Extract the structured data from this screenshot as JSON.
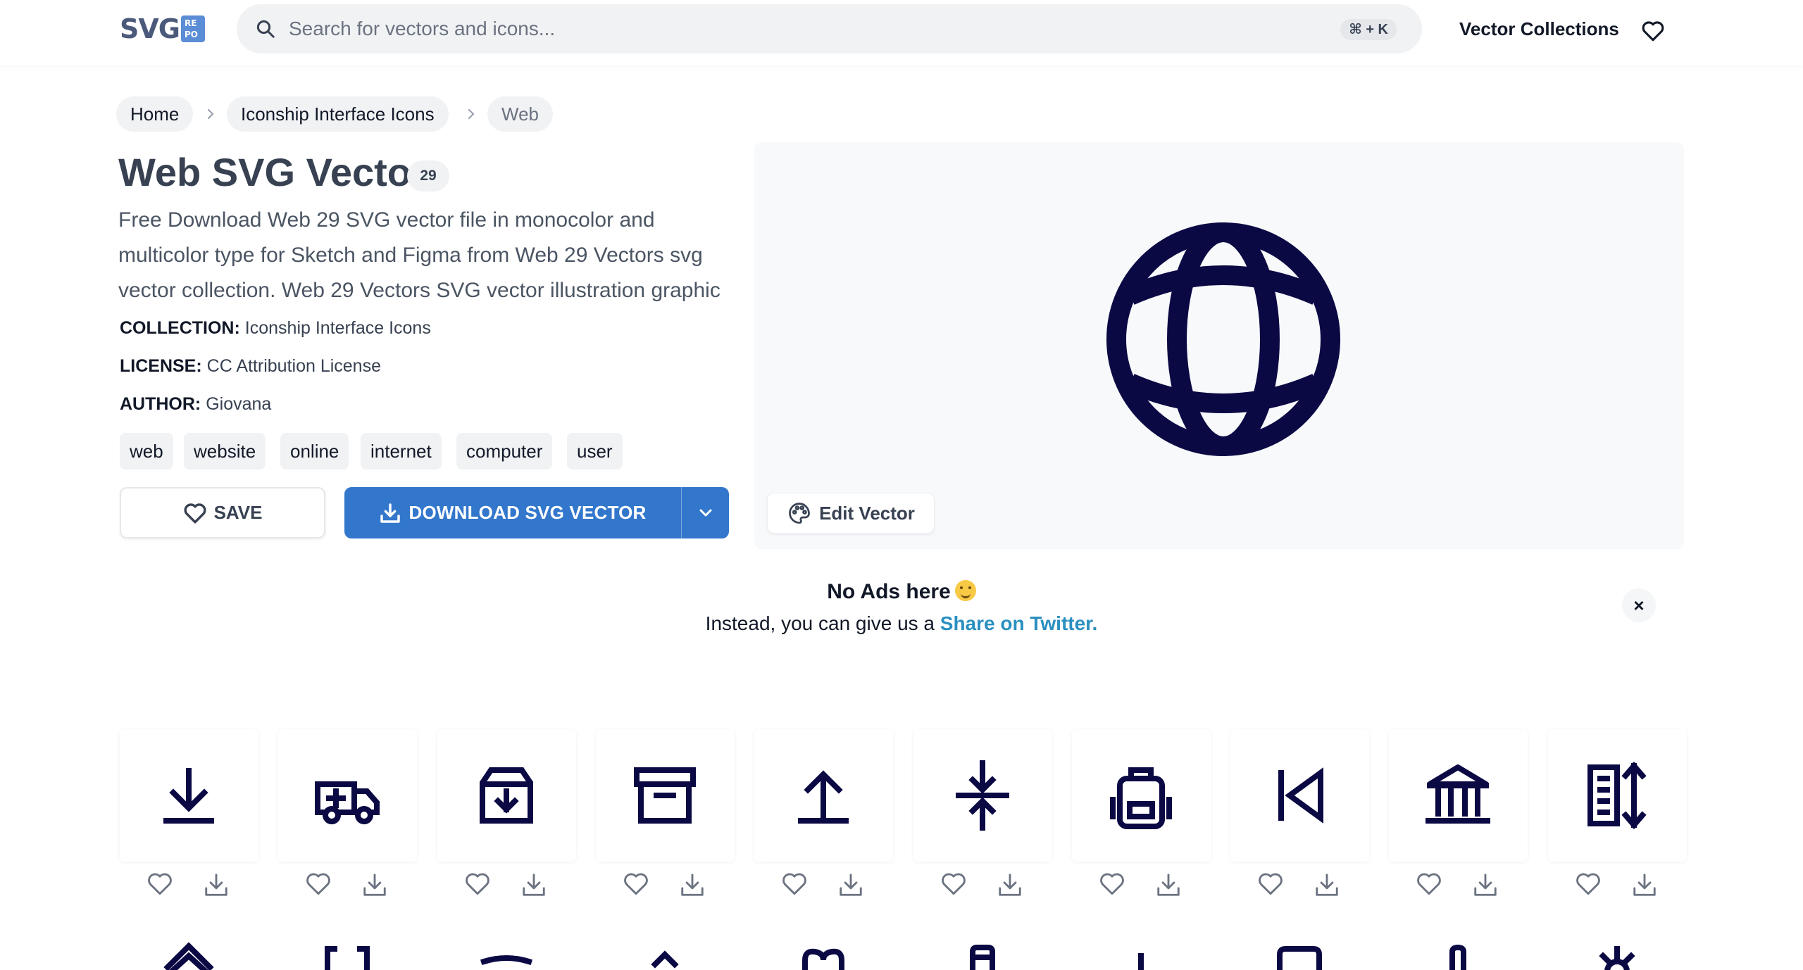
{
  "header": {
    "logo_text": "SVG",
    "logo_badge": [
      "RE",
      "PO"
    ],
    "search_placeholder": "Search for vectors and icons...",
    "shortcut": "⌘ + K",
    "nav_collections": "Vector Collections"
  },
  "breadcrumb": [
    "Home",
    "Iconship Interface Icons",
    "Web"
  ],
  "detail": {
    "title": "Web SVG Vector",
    "count": "29",
    "description": "Free Download Web 29 SVG vector file in monocolor and multicolor type for Sketch and Figma from Web 29 Vectors svg vector collection. Web 29 Vectors SVG vector illustration graphic",
    "collection_label": "COLLECTION:",
    "collection_value": "Iconship Interface Icons",
    "license_label": "LICENSE:",
    "license_value": "CC Attribution License",
    "author_label": "AUTHOR:",
    "author_value": "Giovana",
    "tags": [
      "web",
      "website",
      "online",
      "internet",
      "computer",
      "user"
    ],
    "save_label": "SAVE",
    "download_label": "DOWNLOAD SVG VECTOR",
    "edit_label": "Edit Vector",
    "preview_icon": "globe-icon"
  },
  "no_ads": {
    "title": "No Ads here",
    "subtitle_prefix": "Instead, you can give us a",
    "subtitle_link": "Share on Twitter.",
    "close": "×"
  },
  "icon_grid": {
    "row1": [
      "download-arrow-icon",
      "ambulance-icon",
      "archive-down-icon",
      "archive-box-icon",
      "upload-arrow-icon",
      "compress-vertical-icon",
      "backpack-icon",
      "skip-back-icon",
      "bank-icon",
      "sort-vertical-icon"
    ],
    "row2": [
      "badge-icon",
      "brackets-icon",
      "inbox-icon",
      "arrow-up-icon",
      "heart-icon",
      "document-icon",
      "pin-icon",
      "monitor-icon",
      "pen-icon",
      "sun-icon"
    ]
  },
  "colors": {
    "icon_navy": "#0b0944",
    "primary_blue": "#3377cc",
    "link_blue": "#2a8fc0"
  }
}
